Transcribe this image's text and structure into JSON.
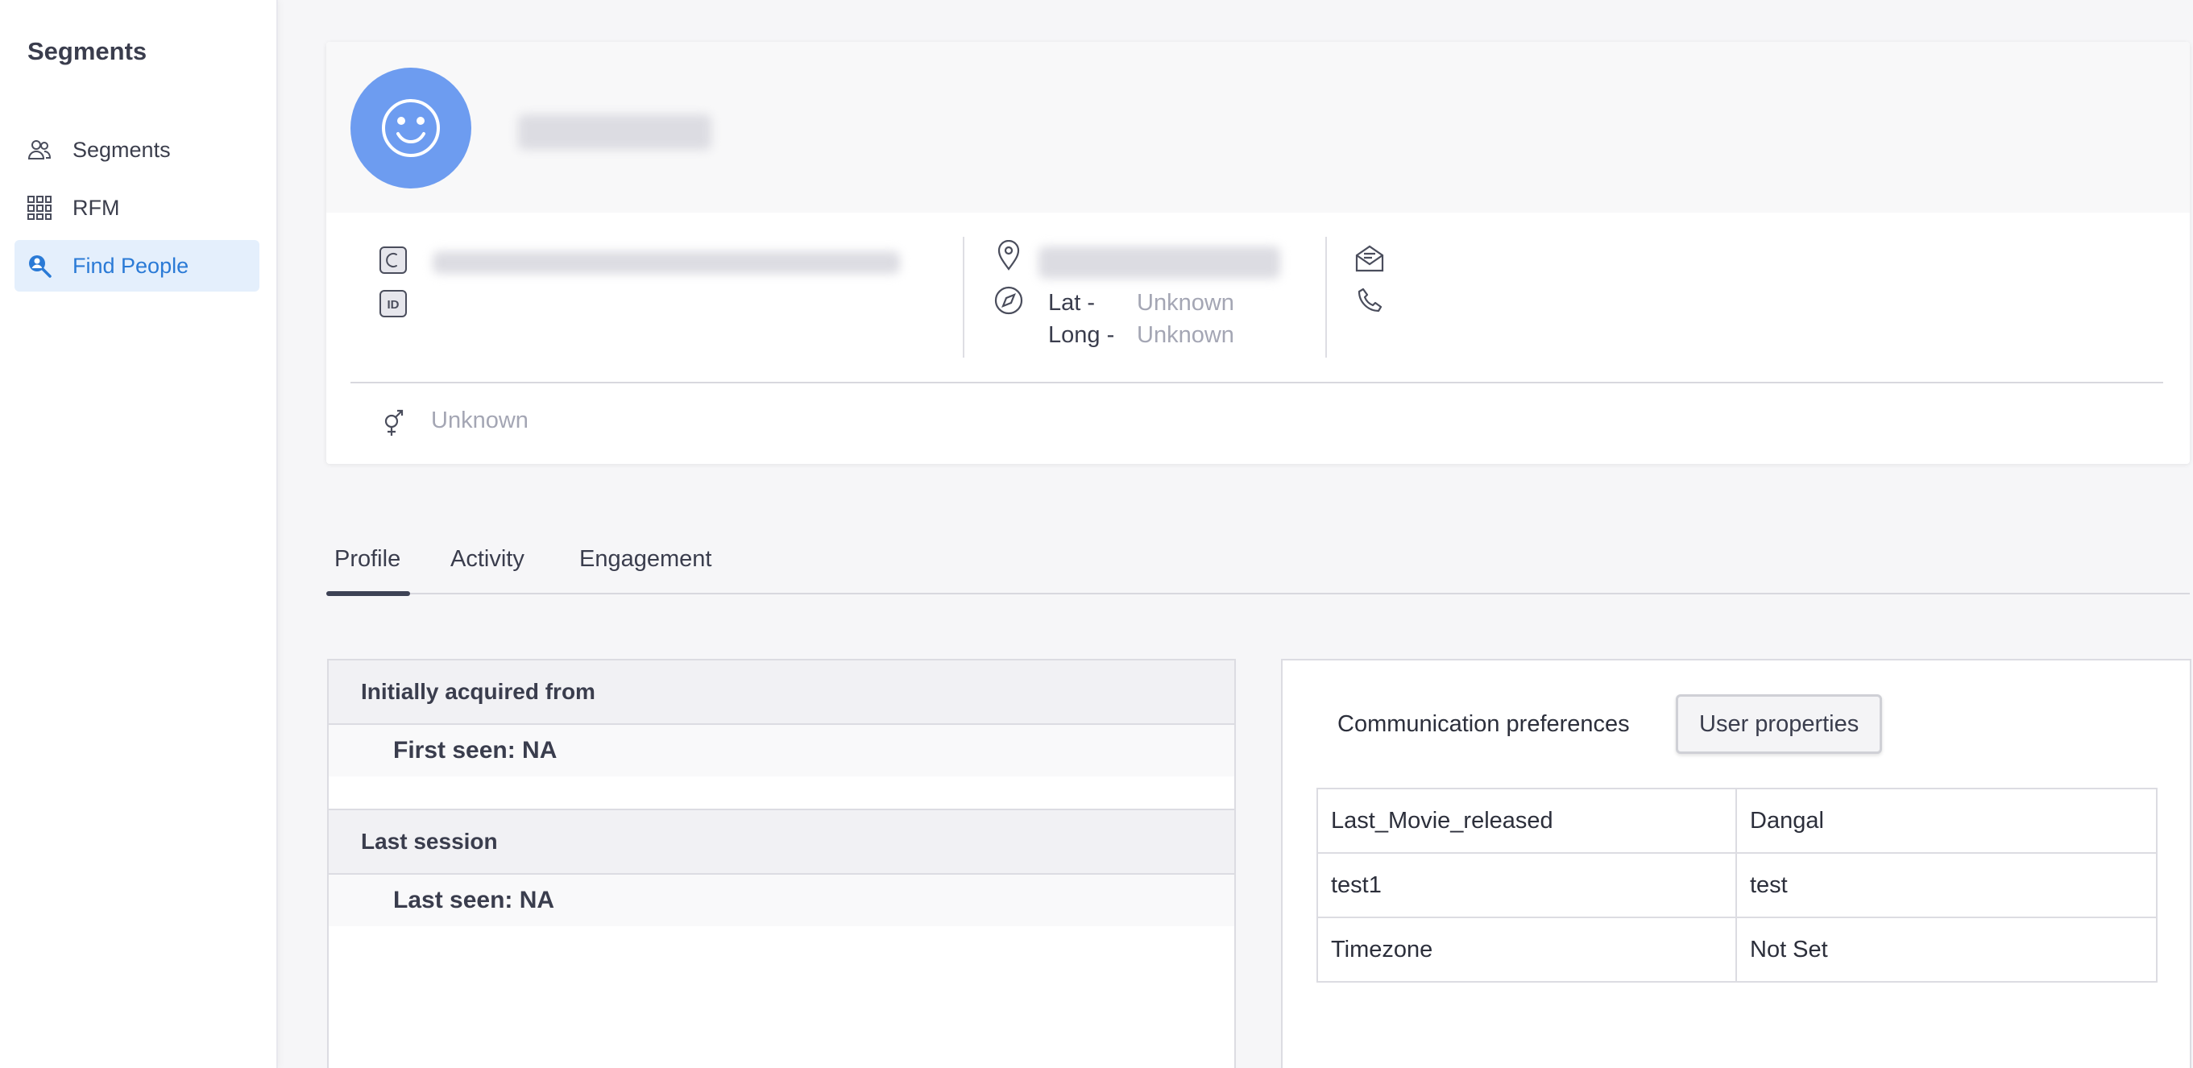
{
  "sidebar": {
    "title": "Segments",
    "items": [
      {
        "label": "Segments",
        "icon": "users-icon"
      },
      {
        "label": "RFM",
        "icon": "grid-icon"
      },
      {
        "label": "Find People",
        "icon": "person-search-icon",
        "active": true
      }
    ]
  },
  "header": {
    "avatar_icon": "smiley-icon",
    "coords": {
      "lat_label": "Lat -",
      "lat_value": "Unknown",
      "long_label": "Long -",
      "long_value": "Unknown"
    },
    "gender_value": "Unknown"
  },
  "tabs": [
    {
      "label": "Profile",
      "active": true
    },
    {
      "label": "Activity"
    },
    {
      "label": "Engagement"
    }
  ],
  "left_panel": {
    "acquired": {
      "title": "Initially acquired from",
      "detail": "First seen: NA"
    },
    "session": {
      "title": "Last session",
      "detail": "Last seen: NA"
    }
  },
  "right_panel": {
    "subtabs": [
      "Communication preferences",
      "User properties"
    ],
    "active_subtab": "User properties",
    "properties": [
      {
        "key": "Last_Movie_released",
        "value": "Dangal"
      },
      {
        "key": "test1",
        "value": "test"
      },
      {
        "key": "Timezone",
        "value": "Not Set"
      }
    ]
  },
  "colors": {
    "accent": "#2a7ad6",
    "active_nav_bg": "#e4effc",
    "avatar_bg": "#6d9cf0",
    "muted_text": "#a4a6b4"
  }
}
